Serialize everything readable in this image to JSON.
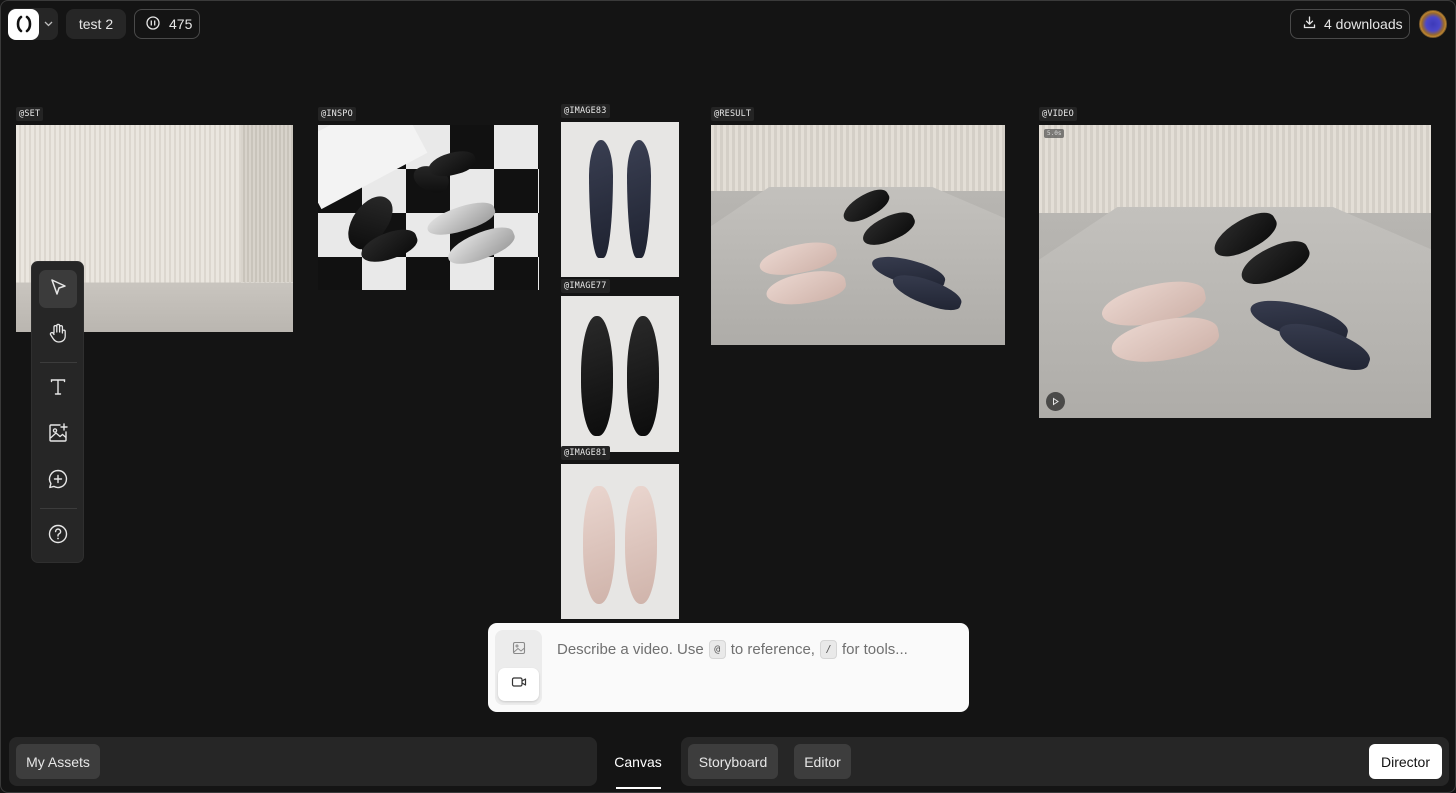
{
  "header": {
    "project_name": "test 2",
    "credits": "475",
    "downloads_label": "4 downloads"
  },
  "canvas": {
    "tags": {
      "set": "@SET",
      "inspo": "@INSPO",
      "image83": "@IMAGE83",
      "image77": "@IMAGE77",
      "image81": "@IMAGE81",
      "result": "@RESULT",
      "video": "@VIDEO"
    },
    "video_duration": "5.0s"
  },
  "prompt": {
    "text_before": "Describe a video. Use",
    "at_key": "@",
    "text_middle": "to reference,",
    "slash_key": "/",
    "text_after": "for tools..."
  },
  "bottom_bar": {
    "my_assets": "My Assets",
    "canvas": "Canvas",
    "storyboard": "Storyboard",
    "editor": "Editor",
    "director": "Director"
  }
}
